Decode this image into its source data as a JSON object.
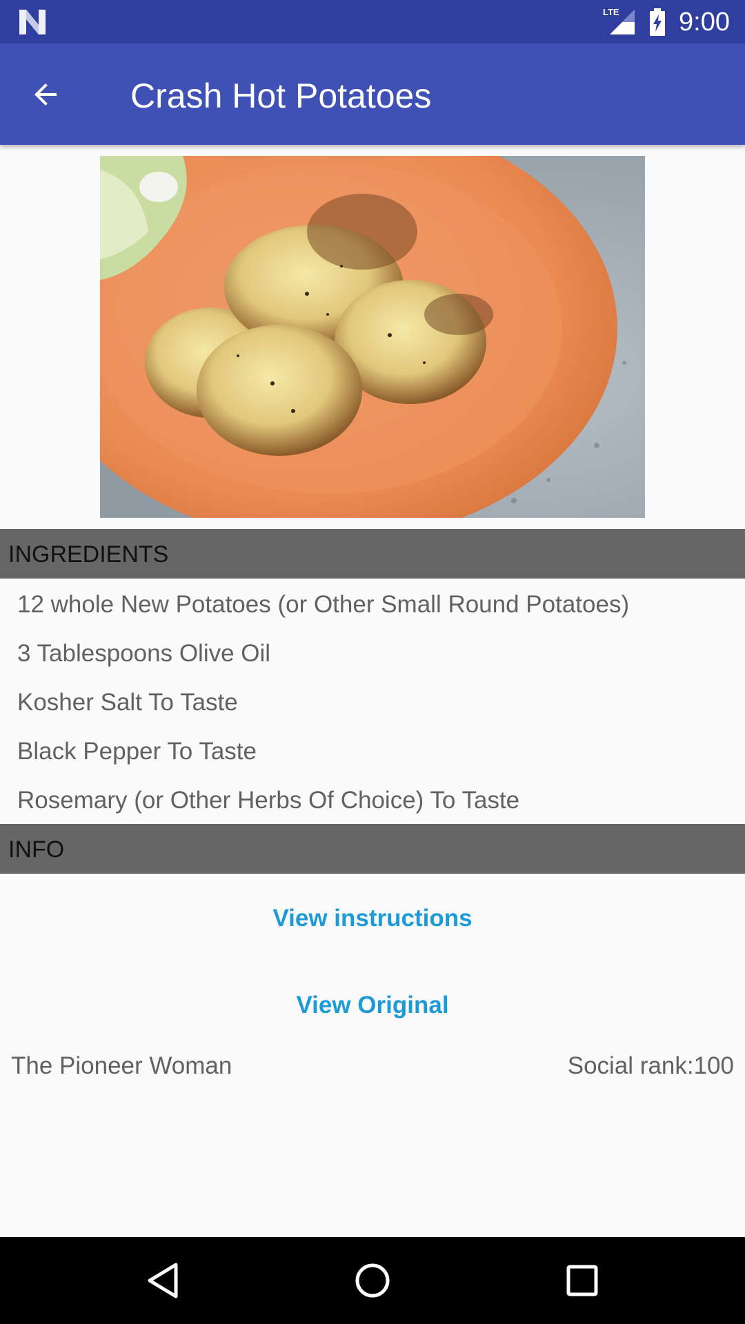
{
  "status_bar": {
    "time": "9:00",
    "network_label": "LTE",
    "icons": [
      "n-logo-icon",
      "lte-signal-icon",
      "battery-charging-icon"
    ]
  },
  "app_bar": {
    "title": "Crash Hot Potatoes",
    "back_icon": "arrow-back-icon",
    "color": "#3f51b5",
    "status_color": "#303f9f"
  },
  "recipe_image": {
    "description_icon": "recipe-photo"
  },
  "sections": {
    "ingredients_title": "INGREDIENTS",
    "info_title": "INFO"
  },
  "ingredients": [
    "12 whole New Potatoes (or Other Small Round Potatoes)",
    "3 Tablespoons Olive Oil",
    "Kosher Salt To Taste",
    "Black Pepper To Taste",
    "Rosemary (or Other Herbs Of Choice) To Taste"
  ],
  "info": {
    "view_instructions_label": "View instructions",
    "view_original_label": "View Original",
    "publisher": "The Pioneer Woman",
    "social_rank": "Social rank:100",
    "link_color": "#1e9bd7"
  },
  "nav_bar": {
    "icons": [
      "nav-back-icon",
      "nav-home-icon",
      "nav-recents-icon"
    ]
  }
}
